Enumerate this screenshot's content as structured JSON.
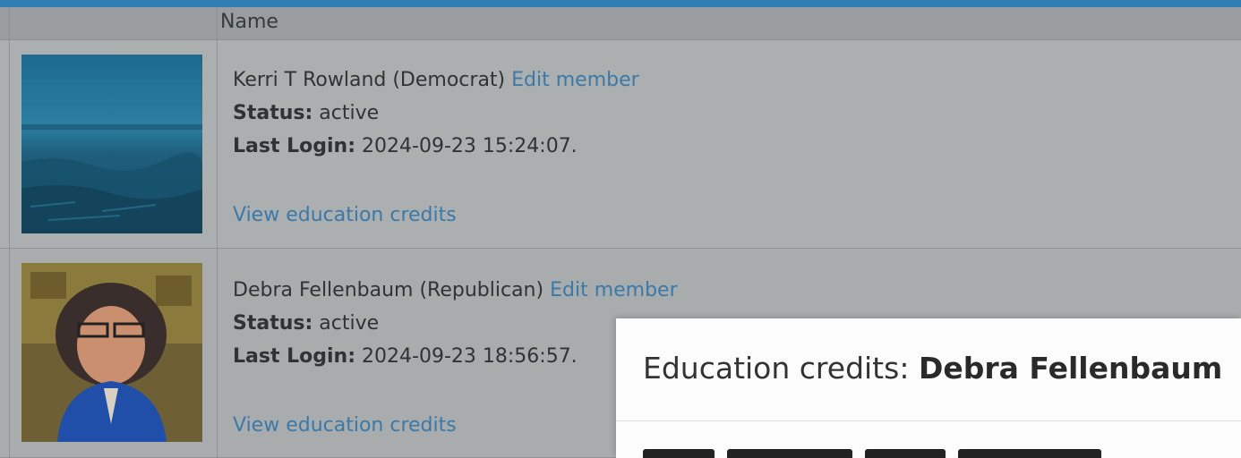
{
  "table": {
    "header": {
      "name_col": "Name"
    },
    "members": [
      {
        "name_party": "Kerri T Rowland (Democrat)",
        "edit_label": "Edit member",
        "status_label": "Status:",
        "status_value": "active",
        "login_label": "Last Login:",
        "login_value": "2024-09-23 15:24:07.",
        "credits_link": "View education credits",
        "photo": "landscape-photo"
      },
      {
        "name_party": "Debra Fellenbaum (Republican)",
        "edit_label": "Edit member",
        "status_label": "Status:",
        "status_value": "active",
        "login_label": "Last Login:",
        "login_value": "2024-09-23 18:56:57.",
        "credits_link": "View education credits",
        "photo": "portrait-photo"
      }
    ]
  },
  "modal": {
    "title_prefix": "Education credits:",
    "title_name": "Debra Fellenbaum"
  },
  "colors": {
    "accent_bar": "#2f7eb3",
    "link": "#3b79a8",
    "background": "#a9adae",
    "modal_bg": "#fcfcfc"
  }
}
